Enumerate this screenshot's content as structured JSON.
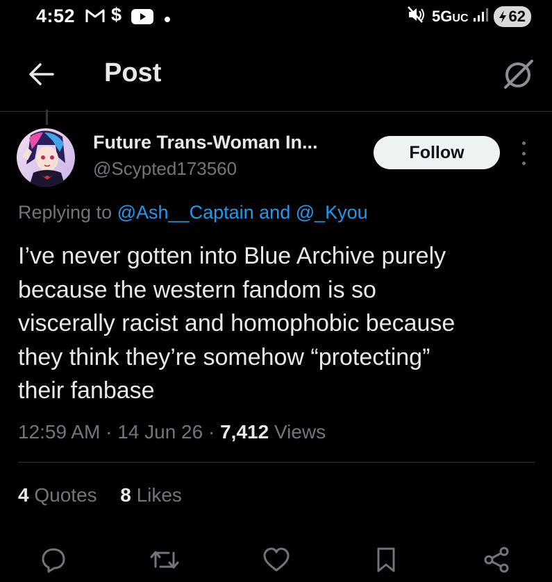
{
  "status_bar": {
    "time": "4:52",
    "network": "5G",
    "network_suffix": "UC",
    "battery": "62",
    "icons": [
      "gmail-icon",
      "dollar-icon",
      "youtube-icon",
      "dot-icon",
      "mute-icon",
      "signal-icon",
      "battery-icon"
    ]
  },
  "header": {
    "back_icon": "back-arrow-icon",
    "title": "Post",
    "grok_icon": "grok-icon"
  },
  "post": {
    "author_name": "Future Trans-Woman In...",
    "author_handle": "@Scypted173560",
    "follow_label": "Follow",
    "replying_prefix": "Replying to",
    "replying_user1": "@Ash__Captain",
    "replying_and": "and",
    "replying_user2": "@_Kyou",
    "text_lines": [
      "I’ve never gotten into Blue Archive purely",
      "because the western fandom is so",
      "viscerally racist and homophobic because",
      "they think they’re somehow “protecting”",
      "their fanbase"
    ],
    "time": "12:59 AM",
    "sep": "·",
    "date": "14 Jun 26",
    "views_count": "7,412",
    "views_label": "Views",
    "quotes_count": "4",
    "quotes_label": "Quotes",
    "likes_count": "8",
    "likes_label": "Likes"
  },
  "actions": [
    "reply-icon",
    "repost-icon",
    "like-icon",
    "bookmark-icon",
    "share-icon"
  ],
  "colors": {
    "background": "#000000",
    "text": "#e7e9ea",
    "secondary": "#71767b",
    "link": "#1d9bf0",
    "divider": "#2f3336"
  }
}
